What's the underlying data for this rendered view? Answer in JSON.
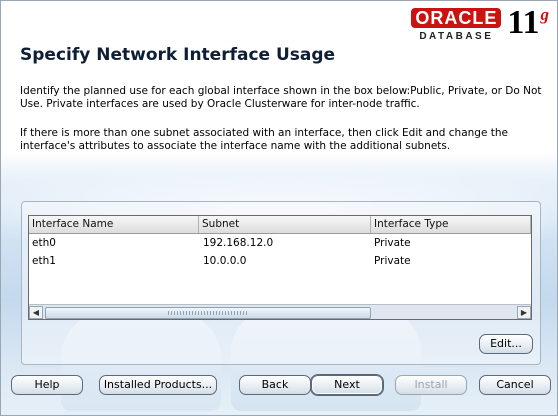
{
  "logo": {
    "brand": "ORACLE",
    "product": "DATABASE",
    "version": "11",
    "version_suffix": "g"
  },
  "page": {
    "title": "Specify Network Interface Usage",
    "description_1": "Identify the planned use for each global interface shown in the box below:Public, Private, or Do Not Use.  Private interfaces are used by Oracle Clusterware for inter-node traffic.",
    "description_2": "If there is more than one subnet associated with an interface, then click Edit and change the interface's attributes to associate the interface name with the additional subnets."
  },
  "table": {
    "columns": [
      "Interface Name",
      "Subnet",
      "Interface Type"
    ],
    "rows": [
      [
        "eth0",
        "192.168.12.0",
        "Private"
      ],
      [
        "eth1",
        "10.0.0.0",
        "Private"
      ]
    ]
  },
  "buttons": {
    "edit": "Edit...",
    "help": "Help",
    "installed_products": "Installed Products...",
    "back": "Back",
    "next": "Next",
    "install": "Install",
    "cancel": "Cancel"
  },
  "icons": {
    "scroll_left": "left-arrow-icon",
    "scroll_right": "right-arrow-icon"
  }
}
